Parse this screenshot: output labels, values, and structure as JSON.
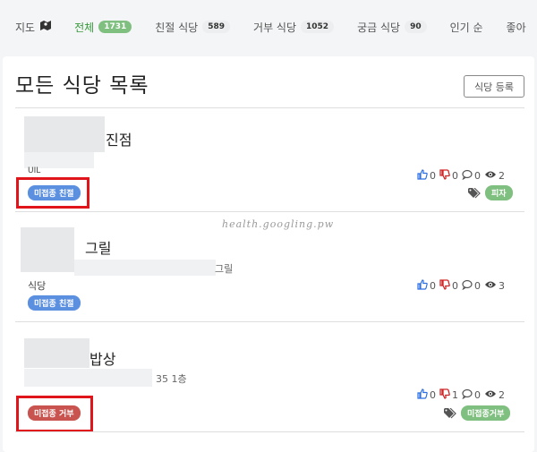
{
  "nav": {
    "items": [
      {
        "label": "지도",
        "icon": "map-icon"
      },
      {
        "label": "전체",
        "count": "1731",
        "active": true
      },
      {
        "label": "친절 식당",
        "count": "589"
      },
      {
        "label": "거부 식당",
        "count": "1052"
      },
      {
        "label": "궁금 식당",
        "count": "90"
      },
      {
        "label": "인기 순"
      },
      {
        "label": "좋아"
      }
    ]
  },
  "page": {
    "title": "모든 식당 목록",
    "register_label": "식당 등록"
  },
  "restaurants": [
    {
      "name_suffix": "진점",
      "category": "UIL",
      "badge": "미접종 친절",
      "stats": {
        "likes": "0",
        "dislikes": "0",
        "comments": "0",
        "views": "2"
      },
      "tag": "피자"
    },
    {
      "name_suffix": "그릴",
      "address_suffix": "그릴",
      "category": "식당",
      "badge": "미접종 친절",
      "stats": {
        "likes": "0",
        "dislikes": "0",
        "comments": "0",
        "views": "3"
      }
    },
    {
      "name_suffix": "밥상",
      "address_suffix": "35 1층",
      "badge": "미접종 거부",
      "stats": {
        "likes": "0",
        "dislikes": "1",
        "comments": "0",
        "views": "2"
      },
      "tag": "미접종거부"
    }
  ],
  "watermark": "health.googling.pw",
  "colors": {
    "accent": "#3a9a3f",
    "highlight": "#e0141b",
    "badge_blue": "#5b8fe0",
    "badge_red": "#c9534f",
    "badge_green": "#7fbf7f"
  }
}
